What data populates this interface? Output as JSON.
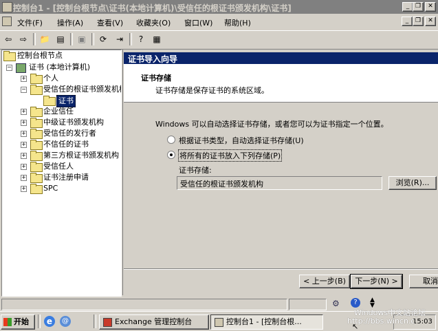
{
  "window": {
    "title": "控制台1 - [控制台根节点\\证书(本地计算机)\\受信任的根证书颁发机构\\证书]"
  },
  "menu": [
    "文件(F)",
    "操作(A)",
    "查看(V)",
    "收藏夹(O)",
    "窗口(W)",
    "帮助(H)"
  ],
  "tree": {
    "root": "控制台根节点",
    "certs": "证书 (本地计算机)",
    "items": [
      "个人",
      "受信任的根证书颁发机构",
      "证书",
      "企业信任",
      "中级证书颁发机构",
      "受信任的发行者",
      "不信任的证书",
      "第三方根证书颁发机构",
      "受信任人",
      "证书注册申请",
      "SPC"
    ]
  },
  "wizard": {
    "title": "证书导入向导",
    "header_title": "证书存储",
    "header_desc": "证书存储是保存证书的系统区域。",
    "intro": "Windows 可以自动选择证书存储，或者您可以为证书指定一个位置。",
    "radio_auto": "根据证书类型，自动选择证书存储(U)",
    "radio_manual": "将所有的证书放入下列存储(P)",
    "store_label": "证书存储:",
    "store_value": "受信任的根证书颁发机构",
    "browse": "浏览(R)...",
    "back": "< 上一步(B)",
    "next": "下一步(N) >",
    "cancel": "取消"
  },
  "taskbar": {
    "start": "开始",
    "task1": "Exchange 管理控制台",
    "task2": "控制台1 - [控制台根...",
    "clock": "15:03"
  },
  "watermark": {
    "line1": "Windows中文站论坛",
    "line2": "http://bbs.wincn.c"
  },
  "colors": {
    "title_bar_inactive": "#808080",
    "wizard_title": "#0a246a",
    "face": "#d4d0c8"
  }
}
